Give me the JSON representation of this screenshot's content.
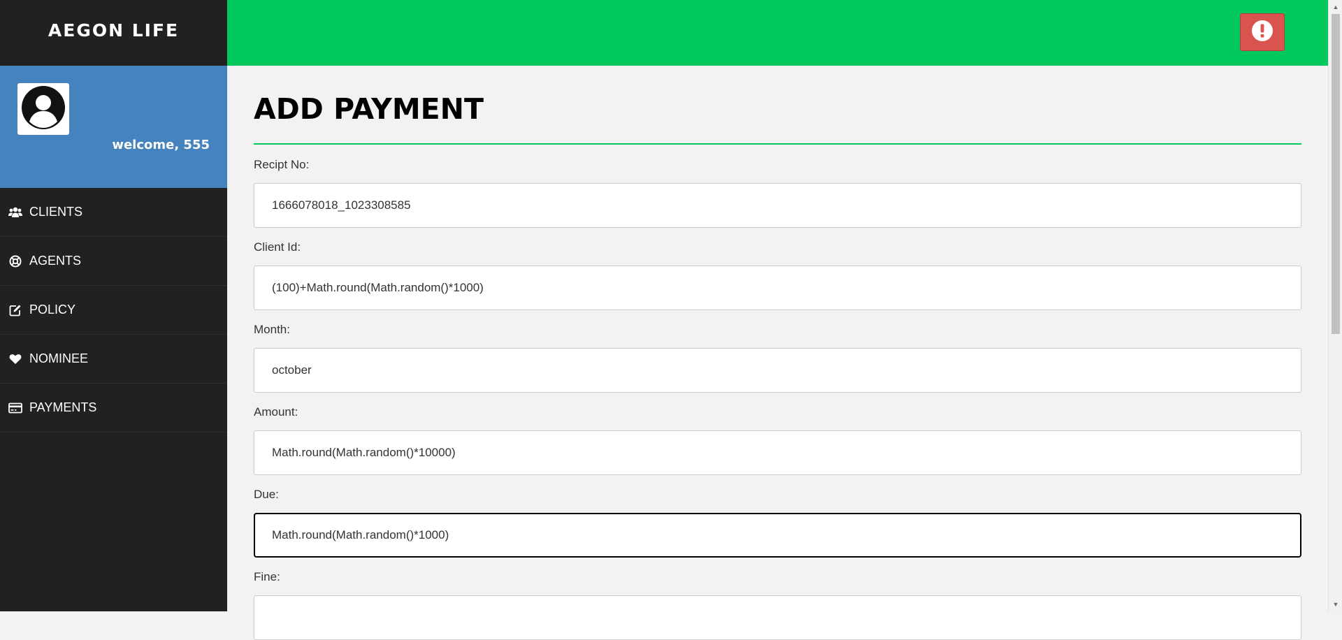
{
  "app": {
    "brand": "AEGON LIFE",
    "welcome": "welcome, 555"
  },
  "sidebar": {
    "items": [
      {
        "label": "CLIENTS",
        "icon": "users-icon"
      },
      {
        "label": "AGENTS",
        "icon": "life-ring-icon"
      },
      {
        "label": "POLICY",
        "icon": "edit-icon"
      },
      {
        "label": "NOMINEE",
        "icon": "heart-icon"
      },
      {
        "label": "PAYMENTS",
        "icon": "credit-card-icon"
      }
    ]
  },
  "header": {
    "alert_icon": "exclamation-circle-icon"
  },
  "form": {
    "title": "ADD PAYMENT",
    "fields": [
      {
        "label": "Recipt No:",
        "value": "1666078018_1023308585"
      },
      {
        "label": "Client Id:",
        "value": "(100)+Math.round(Math.random()*1000)"
      },
      {
        "label": "Month:",
        "value": "october"
      },
      {
        "label": "Amount:",
        "value": "Math.round(Math.random()*10000)"
      },
      {
        "label": "Due:",
        "value": "Math.round(Math.random()*1000)"
      },
      {
        "label": "Fine:",
        "value": ""
      }
    ]
  },
  "colors": {
    "sidebar_bg": "#212121",
    "profile_bg": "#4483bd",
    "topbar_bg": "#00c85c",
    "alert_bg": "#d9534f",
    "content_bg": "#f2f2f2"
  }
}
